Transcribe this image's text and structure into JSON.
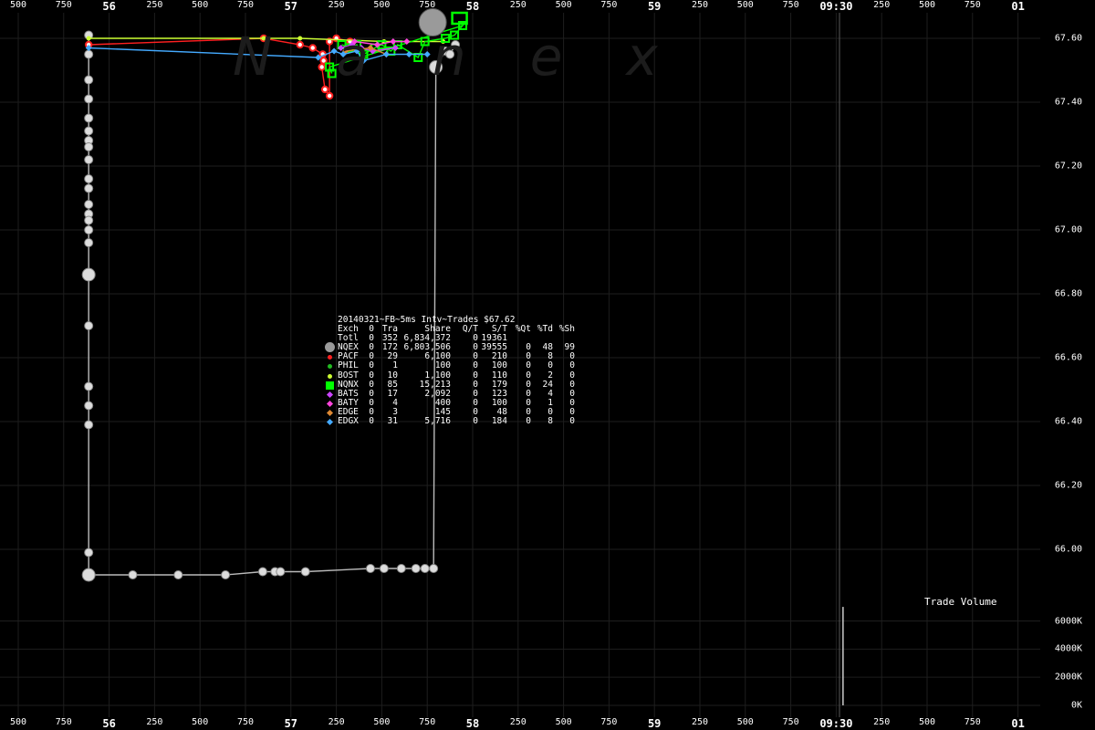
{
  "chart_data": {
    "type": "scatter",
    "title": "20140321~FB~5ms Intv~Trades $67.62",
    "watermark": "Nanex",
    "x_ticks_top": [
      "500",
      "750",
      "56",
      "250",
      "500",
      "750",
      "57",
      "250",
      "500",
      "750",
      "58",
      "250",
      "500",
      "750",
      "59",
      "250",
      "500",
      "750",
      "09:30",
      "250",
      "500",
      "750",
      "01"
    ],
    "x_ticks_bottom": [
      "500",
      "750",
      "56",
      "250",
      "500",
      "750",
      "57",
      "250",
      "500",
      "750",
      "58",
      "250",
      "500",
      "750",
      "59",
      "250",
      "500",
      "750",
      "09:30",
      "250",
      "500",
      "750",
      "01"
    ],
    "y_ticks": [
      "67.60",
      "67.40",
      "67.20",
      "67.00",
      "66.80",
      "66.60",
      "66.40",
      "66.20",
      "66.00"
    ],
    "ylim": [
      65.88,
      67.63
    ],
    "volume_panel": {
      "title": "Trade Volume",
      "ticks": [
        "6000K",
        "4000K",
        "2000K",
        "0K"
      ],
      "ylim": [
        0,
        7200000
      ],
      "spike_at_index": 18.15,
      "spike_value": 7000000
    },
    "stats_table": {
      "headers": [
        "Exch",
        "0",
        "Tra",
        "Share",
        "Q/T",
        "S/T",
        "%Qt",
        "%Td",
        "%Sh"
      ],
      "rows": [
        {
          "sym": "",
          "color": "#ffffff",
          "cells": [
            "Totl",
            "0",
            "352",
            "6,834,372",
            "0",
            "19361",
            "",
            "",
            ""
          ]
        },
        {
          "sym": "circle-large",
          "color": "#9a9a9a",
          "cells": [
            "NQEX",
            "0",
            "172",
            "6,803,506",
            "0",
            "39555",
            "0",
            "48",
            "99"
          ]
        },
        {
          "sym": "circle",
          "color": "#ff2020",
          "cells": [
            "PACF",
            "0",
            "29",
            "6,100",
            "0",
            "210",
            "0",
            "8",
            "0"
          ]
        },
        {
          "sym": "circle",
          "color": "#22bb22",
          "cells": [
            "PHIL",
            "0",
            "1",
            "100",
            "0",
            "100",
            "0",
            "0",
            "0"
          ]
        },
        {
          "sym": "circle",
          "color": "#ccff33",
          "cells": [
            "BOST",
            "0",
            "10",
            "1,100",
            "0",
            "110",
            "0",
            "2",
            "0"
          ]
        },
        {
          "sym": "square",
          "color": "#00ff00",
          "cells": [
            "NQNX",
            "0",
            "85",
            "15,213",
            "0",
            "179",
            "0",
            "24",
            "0"
          ]
        },
        {
          "sym": "diamond",
          "color": "#cc44ff",
          "cells": [
            "BATS",
            "0",
            "17",
            "2,092",
            "0",
            "123",
            "0",
            "4",
            "0"
          ]
        },
        {
          "sym": "diamond",
          "color": "#ff44dd",
          "cells": [
            "BATY",
            "0",
            "4",
            "400",
            "0",
            "100",
            "0",
            "1",
            "0"
          ]
        },
        {
          "sym": "diamond",
          "color": "#dd8833",
          "cells": [
            "EDGE",
            "0",
            "3",
            "145",
            "0",
            "48",
            "0",
            "0",
            "0"
          ]
        },
        {
          "sym": "diamond",
          "color": "#44aaff",
          "cells": [
            "EDGX",
            "0",
            "31",
            "5,716",
            "0",
            "184",
            "0",
            "8",
            "0"
          ]
        }
      ]
    },
    "series": [
      {
        "name": "NQEX",
        "color": "#bbbbbb",
        "points": [
          [
            1.55,
            67.61
          ],
          [
            1.55,
            67.55
          ],
          [
            1.55,
            67.47
          ],
          [
            1.55,
            67.41
          ],
          [
            1.55,
            67.35
          ],
          [
            1.55,
            67.31
          ],
          [
            1.55,
            67.28
          ],
          [
            1.55,
            67.26
          ],
          [
            1.55,
            67.22
          ],
          [
            1.55,
            67.16
          ],
          [
            1.55,
            67.13
          ],
          [
            1.55,
            67.08
          ],
          [
            1.55,
            67.05
          ],
          [
            1.55,
            67.03
          ],
          [
            1.55,
            67.0
          ],
          [
            1.55,
            66.96
          ],
          [
            1.55,
            66.86
          ],
          [
            1.55,
            66.7
          ],
          [
            1.55,
            66.51
          ],
          [
            1.55,
            66.45
          ],
          [
            1.55,
            66.39
          ],
          [
            1.55,
            65.99
          ],
          [
            1.55,
            65.92
          ],
          [
            2.52,
            65.92
          ],
          [
            3.52,
            65.92
          ],
          [
            4.56,
            65.92
          ],
          [
            5.38,
            65.93
          ],
          [
            5.65,
            65.93
          ],
          [
            5.77,
            65.93
          ],
          [
            6.32,
            65.93
          ],
          [
            7.75,
            65.94
          ],
          [
            8.05,
            65.94
          ],
          [
            8.43,
            65.94
          ],
          [
            8.75,
            65.94
          ],
          [
            8.95,
            65.94
          ],
          [
            9.14,
            65.94
          ],
          [
            9.19,
            67.51
          ],
          [
            9.4,
            67.56
          ],
          [
            9.5,
            67.55
          ],
          [
            9.62,
            67.58
          ]
        ]
      },
      {
        "name": "PACF",
        "color": "#ff2020",
        "points": [
          [
            1.55,
            67.58
          ],
          [
            5.4,
            67.6
          ],
          [
            6.2,
            67.58
          ],
          [
            6.48,
            67.57
          ],
          [
            6.7,
            67.55
          ],
          [
            6.72,
            67.53
          ],
          [
            6.68,
            67.51
          ],
          [
            6.75,
            67.44
          ],
          [
            6.85,
            67.42
          ],
          [
            6.85,
            67.59
          ],
          [
            7.0,
            67.6
          ],
          [
            7.3,
            67.59
          ]
        ]
      },
      {
        "name": "BOST",
        "color": "#ccff33",
        "points": [
          [
            1.55,
            67.6
          ],
          [
            5.4,
            67.6
          ],
          [
            6.2,
            67.6
          ],
          [
            8.05,
            67.59
          ],
          [
            9.35,
            67.59
          ]
        ]
      },
      {
        "name": "NQNX",
        "color": "#00ff00",
        "points": [
          [
            7.12,
            67.58
          ],
          [
            7.28,
            67.57
          ],
          [
            7.45,
            67.58
          ],
          [
            7.6,
            67.55
          ],
          [
            7.85,
            67.57
          ],
          [
            8.0,
            67.58
          ],
          [
            8.2,
            67.56
          ],
          [
            8.35,
            67.58
          ],
          [
            8.8,
            67.54
          ],
          [
            8.95,
            67.59
          ],
          [
            9.4,
            67.6
          ],
          [
            9.6,
            67.61
          ],
          [
            9.78,
            67.64
          ],
          [
            6.85,
            67.51
          ],
          [
            6.9,
            67.49
          ]
        ]
      },
      {
        "name": "BATS",
        "color": "#cc44ff",
        "points": [
          [
            7.1,
            67.57
          ],
          [
            7.35,
            67.58
          ],
          [
            7.55,
            67.57
          ],
          [
            7.8,
            67.56
          ],
          [
            8.3,
            67.57
          ]
        ]
      },
      {
        "name": "BATY",
        "color": "#ff44dd",
        "points": [
          [
            7.4,
            67.59
          ],
          [
            7.9,
            67.58
          ],
          [
            8.25,
            67.59
          ],
          [
            8.55,
            67.59
          ]
        ]
      },
      {
        "name": "EDGE",
        "color": "#dd8833",
        "points": [
          [
            7.2,
            67.56
          ],
          [
            7.75,
            67.57
          ],
          [
            8.1,
            67.55
          ]
        ]
      },
      {
        "name": "EDGX",
        "color": "#44aaff",
        "points": [
          [
            1.55,
            67.57
          ],
          [
            6.6,
            67.54
          ],
          [
            6.95,
            67.56
          ],
          [
            7.15,
            67.55
          ],
          [
            7.45,
            67.56
          ],
          [
            7.6,
            67.53
          ],
          [
            8.1,
            67.55
          ],
          [
            8.6,
            67.55
          ],
          [
            9.0,
            67.55
          ]
        ]
      }
    ]
  }
}
